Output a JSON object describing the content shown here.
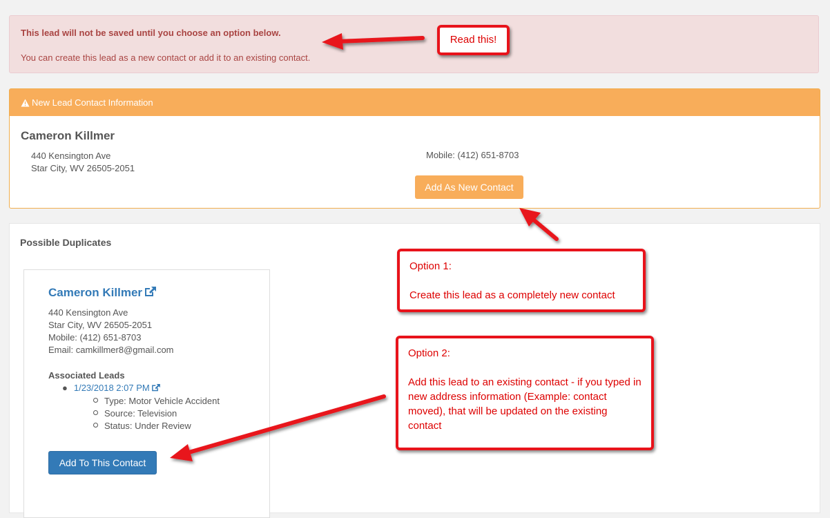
{
  "alert": {
    "strong": "This lead will not be saved until you choose an option below.",
    "message": "You can create this lead as a new contact or add it to an existing contact."
  },
  "new_lead": {
    "heading": "New Lead Contact Information",
    "name": "Cameron Killmer",
    "address_line1": "440 Kensington Ave",
    "address_line2": "Star City, WV 26505-2051",
    "mobile": "Mobile: (412) 651-8703",
    "button_label": "Add As New Contact"
  },
  "duplicates": {
    "title": "Possible Duplicates",
    "card": {
      "name": "Cameron Killmer",
      "lines": [
        "440 Kensington Ave",
        "Star City, WV 26505-2051",
        "Mobile: (412) 651-8703",
        "Email: camkillmer8@gmail.com"
      ],
      "associated_label": "Associated Leads",
      "lead_date": "1/23/2018 2:07 PM",
      "lead_details": [
        "Type: Motor Vehicle Accident",
        "Source: Television",
        "Status: Under Review"
      ],
      "button_label": "Add To This Contact"
    }
  },
  "callouts": {
    "read": "Read this!",
    "option1_title": "Option 1:",
    "option1_text": "Create this lead as a completely new contact",
    "option2_title": "Option 2:",
    "option2_text": "Add this lead to an existing contact - if you typed in new address information (Example: contact moved), that will be updated on the existing contact"
  },
  "colors": {
    "warning": "#f8ad5a",
    "primary": "#337ab7",
    "danger_bg": "#f2dede",
    "danger_text": "#a94442",
    "callout_red": "#e8131b"
  },
  "icons": [
    "warning-icon",
    "external-link-icon",
    "arrow-icon"
  ]
}
